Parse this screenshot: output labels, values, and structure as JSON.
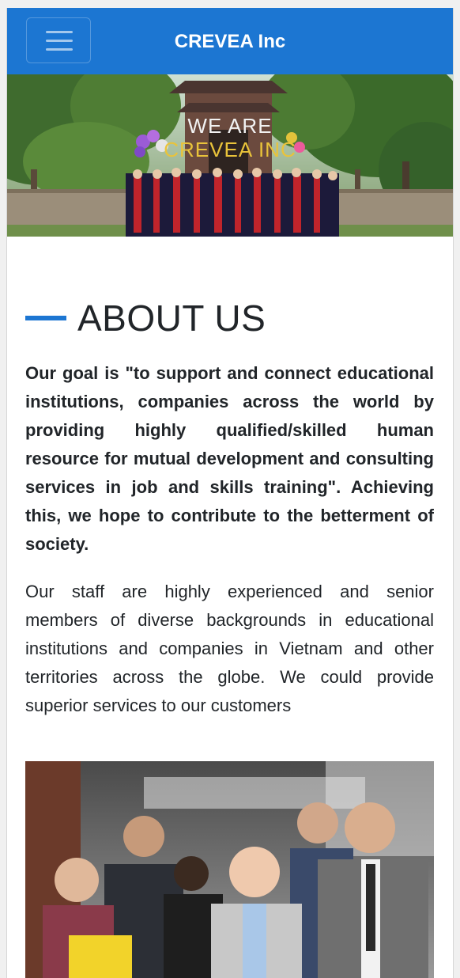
{
  "navbar": {
    "brand": "CREVEA Inc",
    "background_color": "#1c76d2",
    "menu_icon": "hamburger-menu-icon"
  },
  "hero": {
    "overlay_line1": "WE ARE",
    "overlay_line2": "CREVEA INC"
  },
  "about": {
    "heading": "ABOUT US",
    "accent_color": "#1c76d2",
    "lead": "Our goal is \"to support and connect educational institutions, companies across the world by providing highly qualified/skilled human resource for mutual development and consulting services in job and skills training\". Achieving this, we hope to contribute to the betterment of society.",
    "body": "Our staff are highly experienced and senior members of diverse backgrounds in educational institutions and companies in Vietnam and other territories across the globe. We could provide superior services to our customers"
  }
}
